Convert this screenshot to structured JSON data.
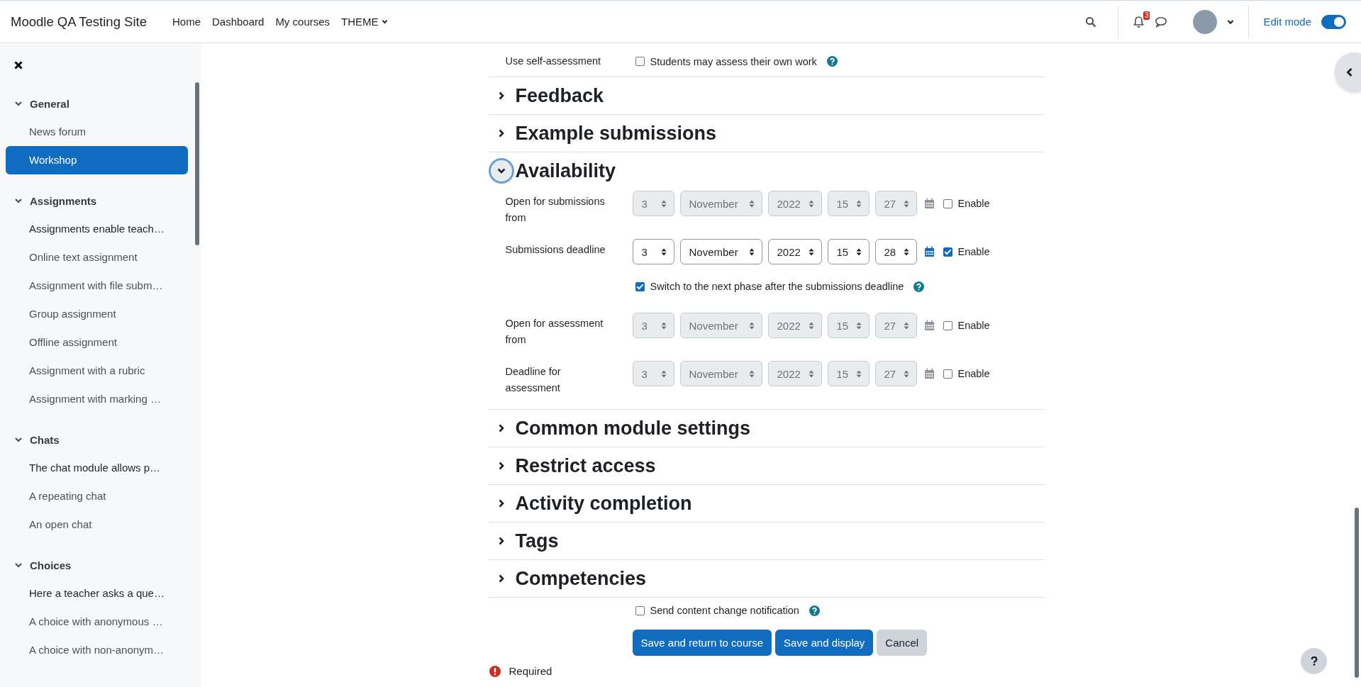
{
  "navbar": {
    "site_name": "Moodle QA Testing Site",
    "links": [
      {
        "label": "Home",
        "dropdown": false
      },
      {
        "label": "Dashboard",
        "dropdown": false
      },
      {
        "label": "My courses",
        "dropdown": false
      },
      {
        "label": "THEME",
        "dropdown": true
      }
    ],
    "notification_count": "3",
    "edit_mode": {
      "label": "Edit mode",
      "on": true
    }
  },
  "sidebar": {
    "sections": [
      {
        "title": "General",
        "expanded": true,
        "items": [
          {
            "label": "News forum",
            "kind": "activity",
            "selected": false
          },
          {
            "label": "Workshop",
            "kind": "activity",
            "selected": true
          }
        ]
      },
      {
        "title": "Assignments",
        "expanded": true,
        "items": [
          {
            "label": "Assignments enable teach…",
            "kind": "label",
            "selected": false
          },
          {
            "label": "Online text assignment",
            "kind": "activity",
            "selected": false
          },
          {
            "label": "Assignment with file subm…",
            "kind": "activity",
            "selected": false
          },
          {
            "label": "Group assignment",
            "kind": "activity",
            "selected": false
          },
          {
            "label": "Offline assignment",
            "kind": "activity",
            "selected": false
          },
          {
            "label": "Assignment with a rubric",
            "kind": "activity",
            "selected": false
          },
          {
            "label": "Assignment with marking …",
            "kind": "activity",
            "selected": false
          }
        ]
      },
      {
        "title": "Chats",
        "expanded": true,
        "items": [
          {
            "label": "The chat module allows p…",
            "kind": "label",
            "selected": false
          },
          {
            "label": "A repeating chat",
            "kind": "activity",
            "selected": false
          },
          {
            "label": "An open chat",
            "kind": "activity",
            "selected": false
          }
        ]
      },
      {
        "title": "Choices",
        "expanded": true,
        "items": [
          {
            "label": "Here a teacher asks a que…",
            "kind": "label",
            "selected": false
          },
          {
            "label": "A choice with anonymous …",
            "kind": "activity",
            "selected": false
          },
          {
            "label": "A choice with non-anonym…",
            "kind": "activity",
            "selected": false
          }
        ]
      }
    ]
  },
  "form": {
    "self_assessment": {
      "label": "Use self-assessment",
      "option": "Students may assess their own work",
      "checked": false
    },
    "sections": [
      {
        "title": "Feedback",
        "expanded": false,
        "focused": false
      },
      {
        "title": "Example submissions",
        "expanded": false,
        "focused": false
      },
      {
        "title": "Availability",
        "expanded": true,
        "focused": true,
        "fields": [
          {
            "kind": "date",
            "label": "Open for submissions from",
            "day": "3",
            "month": "November",
            "year": "2022",
            "hour": "15",
            "minute": "27",
            "enable_label": "Enable",
            "enabled": false
          },
          {
            "kind": "date",
            "label": "Submissions deadline",
            "day": "3",
            "month": "November",
            "year": "2022",
            "hour": "15",
            "minute": "28",
            "enable_label": "Enable",
            "enabled": true
          },
          {
            "kind": "checkbox",
            "label": "Switch to the next phase after the submissions deadline",
            "checked": true
          },
          {
            "kind": "date",
            "label": "Open for assessment from",
            "day": "3",
            "month": "November",
            "year": "2022",
            "hour": "15",
            "minute": "27",
            "enable_label": "Enable",
            "enabled": false
          },
          {
            "kind": "date",
            "label": "Deadline for assessment",
            "day": "3",
            "month": "November",
            "year": "2022",
            "hour": "15",
            "minute": "27",
            "enable_label": "Enable",
            "enabled": false
          }
        ]
      },
      {
        "title": "Common module settings",
        "expanded": false,
        "focused": false
      },
      {
        "title": "Restrict access",
        "expanded": false,
        "focused": false
      },
      {
        "title": "Activity completion",
        "expanded": false,
        "focused": false
      },
      {
        "title": "Tags",
        "expanded": false,
        "focused": false
      },
      {
        "title": "Competencies",
        "expanded": false,
        "focused": false
      }
    ],
    "notification": {
      "label": "Send content change notification",
      "checked": false
    },
    "buttons": [
      {
        "label": "Save and return to course",
        "kind": "primary"
      },
      {
        "label": "Save and display",
        "kind": "primary"
      },
      {
        "label": "Cancel",
        "kind": "secondary"
      }
    ],
    "required_note": "Required"
  }
}
